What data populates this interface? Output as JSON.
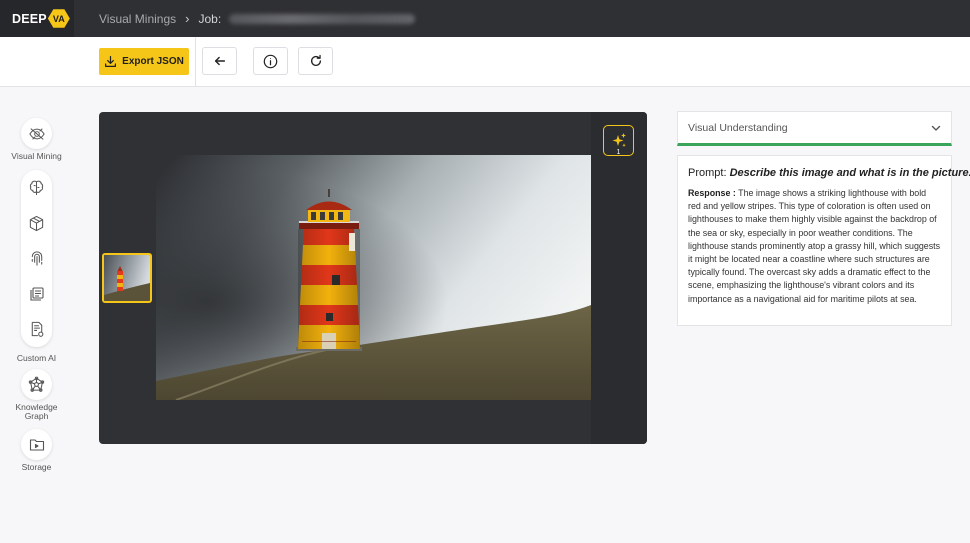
{
  "header": {
    "logo_text": "DEEP",
    "logo_badge": "VA",
    "breadcrumb_root": "Visual Minings",
    "breadcrumb_sep": "›",
    "job_label": "Job:"
  },
  "toolbar": {
    "export_label": "Export JSON"
  },
  "sidebar": {
    "visual_mining": "Visual Mining",
    "custom_ai": "Custom AI",
    "knowledge_graph": "Knowledge Graph",
    "storage": "Storage"
  },
  "viewer": {
    "ai_count": "1"
  },
  "panel": {
    "selector_label": "Visual Understanding",
    "prompt_label": "Prompt:",
    "prompt_text": "Describe this image and what is in the picture.",
    "response_label": "Response :",
    "response_text": "The image shows a striking lighthouse with bold red and yellow stripes. This type of coloration is often used on lighthouses to make them highly visible against the backdrop of the sea or sky, especially in poor weather conditions. The lighthouse stands prominently atop a grassy hill, which suggests it might be located near a coastline where such structures are typically found. The overcast sky adds a dramatic effect to the scene, emphasizing the lighthouse's vibrant colors and its importance as a navigational aid for maritime pilots at sea."
  },
  "colors": {
    "accent": "#f5c518",
    "header_bg": "#2f3034",
    "success": "#3aa55a"
  },
  "icons": {
    "export": "download-icon",
    "back": "arrow-left-icon",
    "info": "info-icon",
    "refresh": "refresh-icon",
    "ai": "sparkles-icon",
    "selector": "chevron-down-icon"
  }
}
